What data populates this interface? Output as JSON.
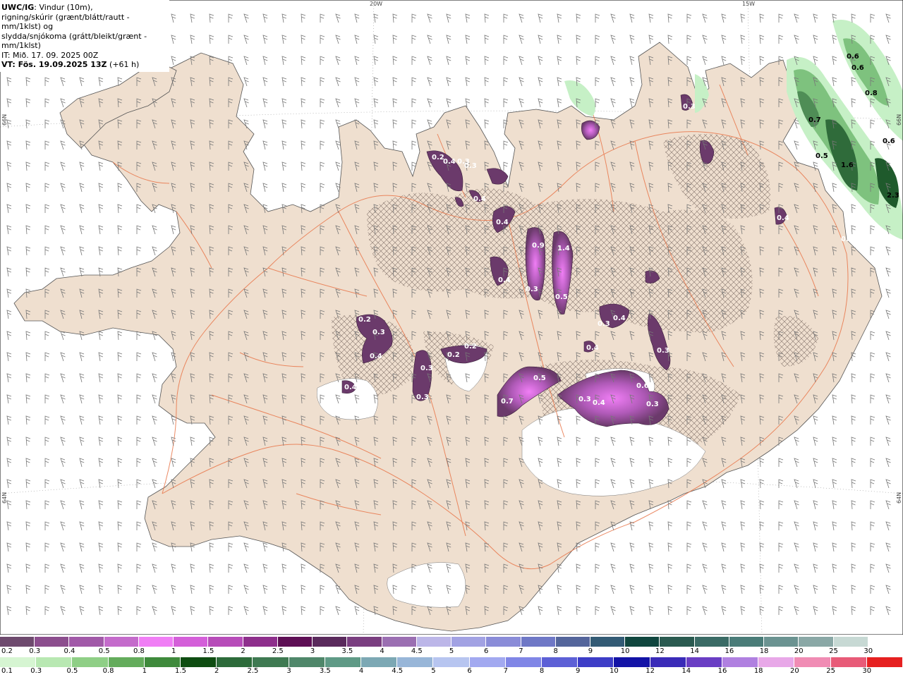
{
  "header": {
    "model": "UWC/IG",
    "param_line1": ": Vindur (10m),",
    "param_line2": "rigning/skúrir (grænt/blátt/rautt - mm/1klst) og",
    "param_line3": "slydda/snjókoma (grátt/bleikt/grænt - mm/1klst)",
    "init_time": "IT: Mið. 17. 09. 2025 00Z",
    "valid_label": "VT: Fös. 19.09.2025 13Z",
    "lead": " (+61 h)"
  },
  "coords": {
    "top_20w": "20W",
    "top_15w": "15W",
    "left_66n": "66N",
    "left_64n": "64N",
    "right_66n": "66N",
    "right_64n": "64N"
  },
  "colors": {
    "land": "#efdfcf",
    "water": "#ffffff",
    "roads": "#e8764a",
    "coast": "#555555",
    "snow_purple": "#6b3a6b",
    "snow_violet": "#b05ab8",
    "snow_pink": "#e58ae8",
    "rain_light": "#b9efbc",
    "rain_mid": "#6fb576",
    "rain_dark": "#1f5a2c"
  },
  "snow_labels": [
    "0.2",
    "0.3",
    "0.4",
    "0.3",
    "0.2",
    "0.2",
    "0.3",
    "0.3",
    "0.3",
    "0.4",
    "0.4",
    "0.9",
    "1.4",
    "0.3",
    "0.5",
    "0.4",
    "0.3",
    "0.4",
    "0.3",
    "0.7",
    "0.5",
    "0.3",
    "0.4",
    "0.3",
    "0.6",
    "0.4",
    "0.4",
    "0.2",
    "0.4",
    "0.4",
    "0.3",
    "0.3"
  ],
  "rain_labels": [
    "0.6",
    "0.6",
    "0.8",
    "0.7",
    "0.6",
    "0.5",
    "1.6",
    "2.3"
  ],
  "legend_snow": {
    "labels": [
      "0.2",
      "0.3",
      "0.4",
      "0.5",
      "0.8",
      "1",
      "1.5",
      "2",
      "2.5",
      "3",
      "3.5",
      "4",
      "4.5",
      "5",
      "6",
      "7",
      "8",
      "9",
      "10",
      "12",
      "14",
      "16",
      "18",
      "20",
      "25",
      "30"
    ],
    "colors": [
      "#6e4a6e",
      "#8c4e8e",
      "#a159a8",
      "#c46bcb",
      "#f07ef5",
      "#d45fd9",
      "#b74cb9",
      "#8e2f8c",
      "#5e0f55",
      "#5a2a5c",
      "#7a3e80",
      "#9b6fb2",
      "#bcb6e8",
      "#a2a2e3",
      "#8a8cd8",
      "#6f78c6",
      "#54659b",
      "#335b75",
      "#10463e",
      "#2a5a50",
      "#3a6b65",
      "#4a7c78",
      "#6b9391",
      "#8aa8a6",
      "#c7d9d4",
      "#ffffff"
    ]
  },
  "legend_rain": {
    "labels": [
      "0.1",
      "0.3",
      "0.5",
      "0.8",
      "1",
      "1.5",
      "2",
      "2.5",
      "3",
      "3.5",
      "4",
      "4.5",
      "5",
      "6",
      "7",
      "8",
      "9",
      "10",
      "12",
      "14",
      "16",
      "18",
      "20",
      "25",
      "30"
    ],
    "colors": [
      "#d6f5d2",
      "#b8e8b2",
      "#8fcf86",
      "#64ac5c",
      "#3f8a3c",
      "#0f4d12",
      "#2d6b3a",
      "#3f7a52",
      "#4f876a",
      "#5f9a86",
      "#7ca8b4",
      "#98b6d8",
      "#b7c5f0",
      "#a2a9f0",
      "#8086e6",
      "#5d60d6",
      "#3d3dc7",
      "#1313a6",
      "#3a2bb8",
      "#6a3ec4",
      "#b080e0",
      "#e8a8e8",
      "#f08cb4",
      "#e85b78",
      "#e62020"
    ]
  }
}
